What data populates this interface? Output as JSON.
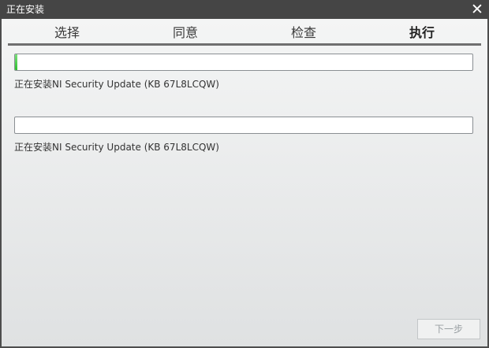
{
  "window": {
    "title": "正在安装",
    "close_symbol": "✕"
  },
  "tabs": [
    {
      "label": "选择",
      "active": false
    },
    {
      "label": "同意",
      "active": false
    },
    {
      "label": "检查",
      "active": false
    },
    {
      "label": "执行",
      "active": true
    }
  ],
  "progress": [
    {
      "fraction": 0.005,
      "status": "正在安装NI Security Update (KB 67L8LCQW)"
    },
    {
      "fraction": 0.0,
      "status": "正在安装NI Security Update (KB 67L8LCQW)"
    }
  ],
  "buttons": {
    "next": "下一步"
  },
  "colors": {
    "progress_fill": "#2fbf2f",
    "titlebar": "#454545"
  }
}
